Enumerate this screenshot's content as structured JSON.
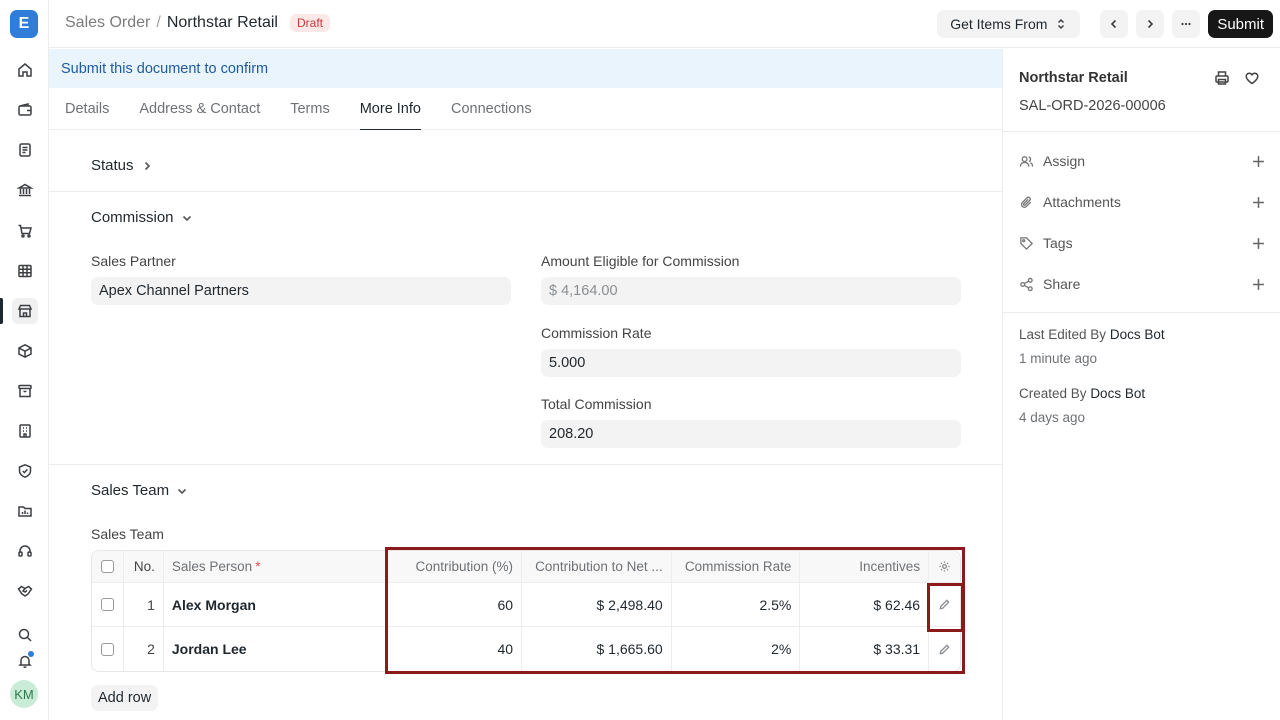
{
  "app": {
    "logo_letter": "E"
  },
  "user": {
    "initials": "KM"
  },
  "header": {
    "parent": "Sales Order",
    "separator": "/",
    "title": "Northstar Retail",
    "status_badge": "Draft",
    "get_items_label": "Get Items From",
    "submit_label": "Submit"
  },
  "alert": {
    "text": "Submit this document to confirm"
  },
  "tabs": [
    {
      "label": "Details"
    },
    {
      "label": "Address & Contact"
    },
    {
      "label": "Terms"
    },
    {
      "label": "More Info"
    },
    {
      "label": "Connections"
    }
  ],
  "sections": {
    "status": {
      "title": "Status"
    },
    "commission": {
      "title": "Commission",
      "sales_partner_label": "Sales Partner",
      "sales_partner_value": "Apex Channel Partners",
      "amount_eligible_label": "Amount Eligible for Commission",
      "amount_eligible_value": "$ 4,164.00",
      "commission_rate_label": "Commission Rate",
      "commission_rate_value": "5.000",
      "total_commission_label": "Total Commission",
      "total_commission_value": "208.20"
    },
    "sales_team": {
      "title": "Sales Team",
      "table_label": "Sales Team",
      "columns": {
        "no": "No.",
        "sales_person": "Sales Person",
        "required_mark": "*",
        "contribution": "Contribution (%)",
        "contribution_net": "Contribution to Net ...",
        "commission_rate": "Commission Rate",
        "incentives": "Incentives"
      },
      "rows": [
        {
          "no": "1",
          "sales_person": "Alex Morgan",
          "contribution": "60",
          "contribution_net": "$ 2,498.40",
          "commission_rate": "2.5%",
          "incentives": "$ 62.46"
        },
        {
          "no": "2",
          "sales_person": "Jordan Lee",
          "contribution": "40",
          "contribution_net": "$ 1,665.60",
          "commission_rate": "2%",
          "incentives": "$ 33.31"
        }
      ],
      "add_row_label": "Add row"
    }
  },
  "sidebar": {
    "title": "Northstar Retail",
    "doc_id": "SAL-ORD-2026-00006",
    "actions": [
      {
        "label": "Assign",
        "icon": "users-icon"
      },
      {
        "label": "Attachments",
        "icon": "paperclip-icon"
      },
      {
        "label": "Tags",
        "icon": "tag-icon"
      },
      {
        "label": "Share",
        "icon": "share-icon"
      }
    ],
    "last_edited_prefix": "Last Edited By",
    "last_edited_by": "Docs Bot",
    "last_edited_time": "1 minute ago",
    "created_prefix": "Created By",
    "created_by": "Docs Bot",
    "created_time": "4 days ago"
  },
  "colors": {
    "accent": "#2f7dd8",
    "highlight_border": "#8b1a1a",
    "alert_bg": "#eaf4fd",
    "draft_badge": "#c83a3a"
  }
}
